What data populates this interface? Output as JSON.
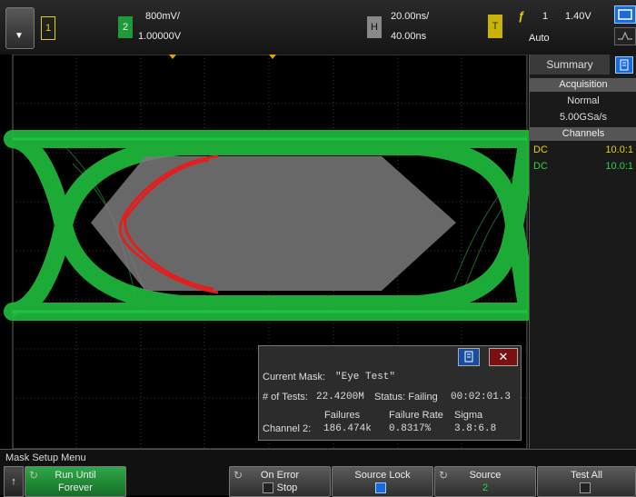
{
  "topbar": {
    "menu_arrow": "▼",
    "ch1_label": "1",
    "ch2_label": "2",
    "ch2_scale": "800mV/",
    "ch2_offset": "1.00000V",
    "h_label": "H",
    "timebase": "20.00ns/",
    "delay": "40.00ns",
    "t_label": "T",
    "trigger_icon": "ƒ",
    "trigger_source": "1",
    "trigger_level": "1.40V",
    "trigger_mode": "Auto",
    "colors": {
      "ch1": "#e8d000",
      "ch2": "#1f9a3a"
    }
  },
  "right_panel": {
    "tab_label": "Summary",
    "acquisition_header": "Acquisition",
    "acq_mode": "Normal",
    "sample_rate": "5.00GSa/s",
    "channels_header": "Channels",
    "channels": [
      {
        "coupling": "DC",
        "probe": "10.0:1",
        "color": "#e8d000"
      },
      {
        "coupling": "DC",
        "probe": "10.0:1",
        "color": "#2fd04a"
      }
    ]
  },
  "mask_dialog": {
    "current_mask_label": "Current Mask:",
    "current_mask_value": "\"Eye Test\"",
    "tests_label": "# of Tests:",
    "tests_value": "22.4200M",
    "status_label": "Status: Failing",
    "elapsed": "00:02:01.3",
    "col_failures": "Failures",
    "col_rate": "Failure Rate",
    "col_sigma": "Sigma",
    "row_label": "Channel 2:",
    "failures": "186.474k",
    "rate": "0.8317%",
    "sigma": "3.8:6.8",
    "close": "✕"
  },
  "softkeys": {
    "menu_title": "Mask Setup Menu",
    "back": "↑",
    "run_until_label": "Run Until",
    "run_until_value": "Forever",
    "on_error_label": "On Error",
    "on_error_value": "Stop",
    "source_lock_label": "Source Lock",
    "source_label": "Source",
    "source_value": "2",
    "test_all_label": "Test All"
  }
}
